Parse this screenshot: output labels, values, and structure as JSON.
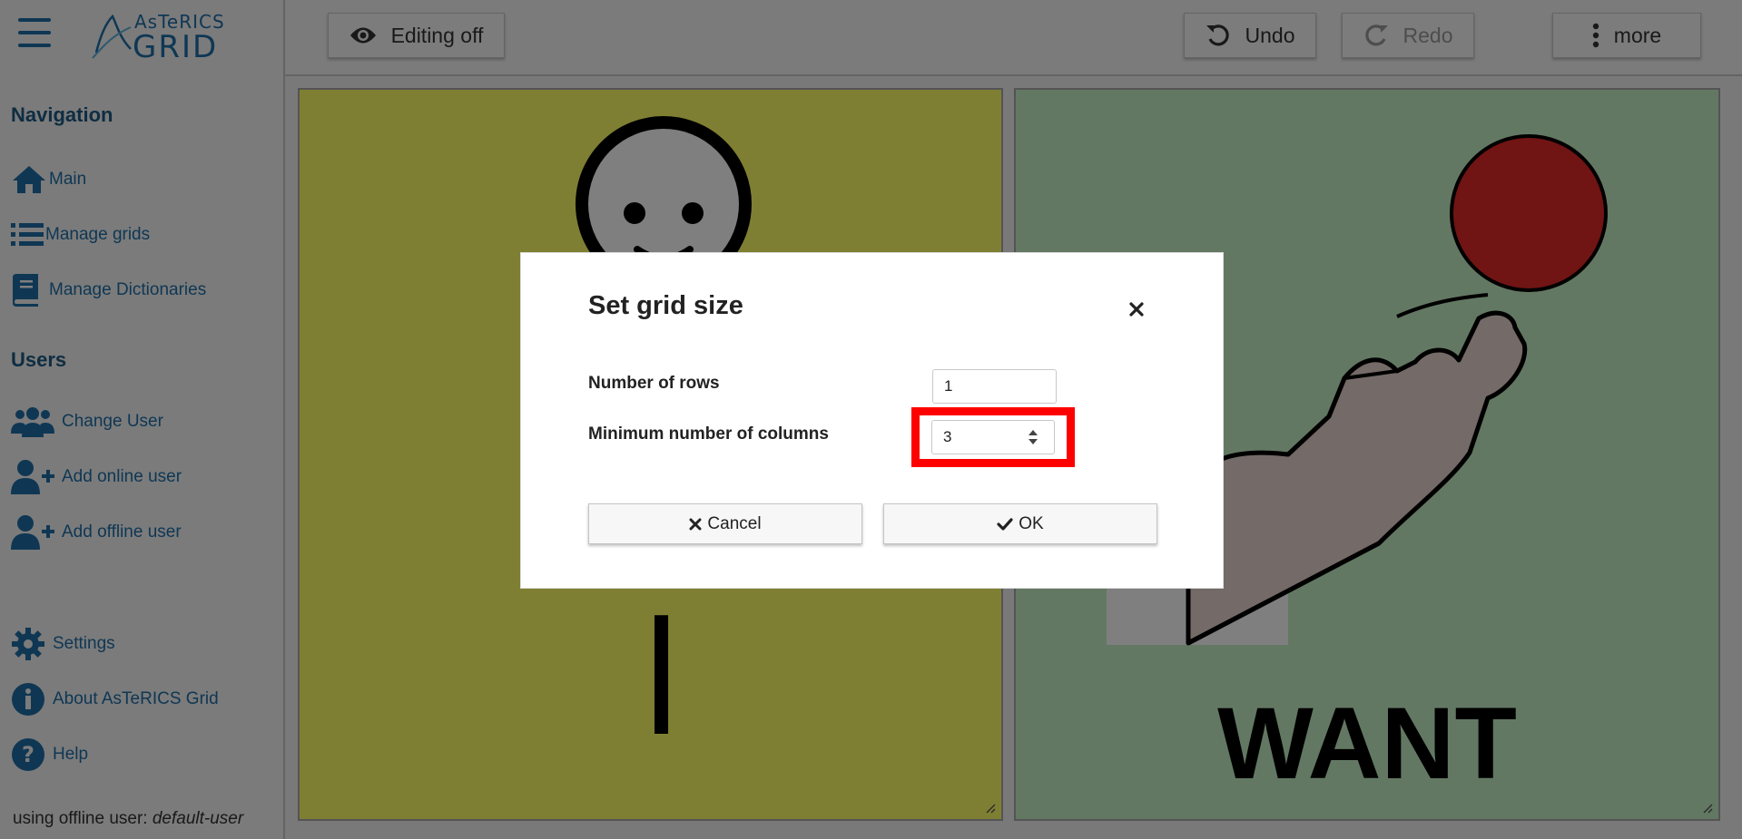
{
  "app": {
    "logo_small": "AsTeRICS",
    "logo_big": "GRID"
  },
  "sidebar": {
    "navigation_heading": "Navigation",
    "navigation_items": [
      {
        "label": "Main",
        "icon": "home-icon"
      },
      {
        "label": "Manage grids",
        "icon": "list-icon"
      },
      {
        "label": "Manage Dictionaries",
        "icon": "book-icon"
      }
    ],
    "users_heading": "Users",
    "user_items": [
      {
        "label": "Change User",
        "icon": "users-icon"
      },
      {
        "label": "Add online user",
        "icon": "user-plus-icon"
      },
      {
        "label": "Add offline user",
        "icon": "user-plus-icon"
      }
    ],
    "bottom_items": [
      {
        "label": "Settings",
        "icon": "gear-icon"
      },
      {
        "label": "About AsTeRICS Grid",
        "icon": "info-icon"
      },
      {
        "label": "Help",
        "icon": "question-icon"
      }
    ],
    "user_status_prefix": "using offline user:",
    "user_status_name": "default-user"
  },
  "toolbar": {
    "editing_label": "Editing off",
    "undo_label": "Undo",
    "redo_label": "Redo",
    "more_label": "more"
  },
  "grid": {
    "cells": [
      {
        "label": "I",
        "background": "#ffff66"
      },
      {
        "label": "WANT",
        "background": "#c7f0c7"
      }
    ]
  },
  "dialog": {
    "title": "Set grid size",
    "rows_label": "Number of rows",
    "rows_value": "1",
    "columns_label": "Minimum number of columns",
    "columns_value": "3",
    "cancel_label": "Cancel",
    "ok_label": "OK"
  },
  "colors": {
    "accent": "#1e6fa8",
    "highlight": "#ff0000"
  }
}
